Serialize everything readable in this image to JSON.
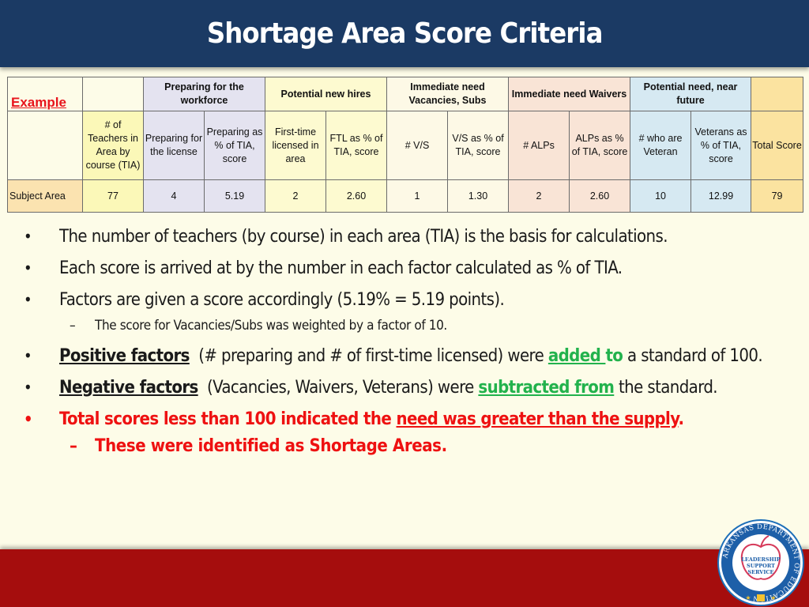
{
  "slide": {
    "title": "Shortage Area Score Criteria"
  },
  "table": {
    "example_label": "Example",
    "group_headers": {
      "preparing": "Preparing for the workforce",
      "potential_hires": "Potential new hires",
      "vacancies": "Immediate need Vacancies, Subs",
      "waivers": "Immediate need Waivers",
      "future": "Potential need, near future"
    },
    "columns": [
      "# of Teachers in Area by course (TIA)",
      "Preparing for the license",
      "Preparing as % of TIA, score",
      "First-time licensed in area",
      "FTL as % of TIA, score",
      "# V/S",
      "V/S as % of TIA, score",
      "# ALPs",
      "ALPs as % of TIA, score",
      "# who are Veteran",
      "Veterans as % of TIA, score",
      "Total Score"
    ],
    "row": {
      "label": "Subject Area",
      "values": [
        "77",
        "4",
        "5.19",
        "2",
        "2.60",
        "1",
        "1.30",
        "2",
        "2.60",
        "10",
        "12.99",
        "79"
      ]
    }
  },
  "bullets": {
    "b1": "The number of teachers (by course) in each area (TIA) is the basis for calculations.",
    "b2": "Each score is arrived at by the number in each factor calculated as % of TIA.",
    "b3": "Factors are given a score accordingly (5.19% = 5.19 points).",
    "b3_sub": "The score for Vacancies/Subs was weighted by a factor of 10.",
    "b4": {
      "lead": "Positive factors",
      "middle": "(# preparing and # of first-time licensed) were",
      "highlight_underlined": "added ",
      "highlight_plain": "to",
      "tail": "a standard of 100."
    },
    "b5": {
      "lead": "Negative factors",
      "middle": "(Vacancies, Waivers, Veterans) were",
      "highlight": "subtracted from",
      "tail": "the standard."
    },
    "b6": {
      "text": "Total scores less than 100 indicated the ",
      "underlined": "need was greater than the supply",
      "end": "."
    },
    "b6_sub": "These were identified as Shortage Areas."
  },
  "logo": {
    "ring_text": "ARKANSAS DEPARTMENT OF EDUCATION",
    "center_lines": [
      "LEADERSHIP",
      "SUPPORT",
      "SERVICE"
    ]
  },
  "colors": {
    "title_bar": "#1b3a64",
    "bottom_band": "#a50d0d",
    "accent_red": "#ee1111",
    "accent_green": "#22b24c"
  }
}
